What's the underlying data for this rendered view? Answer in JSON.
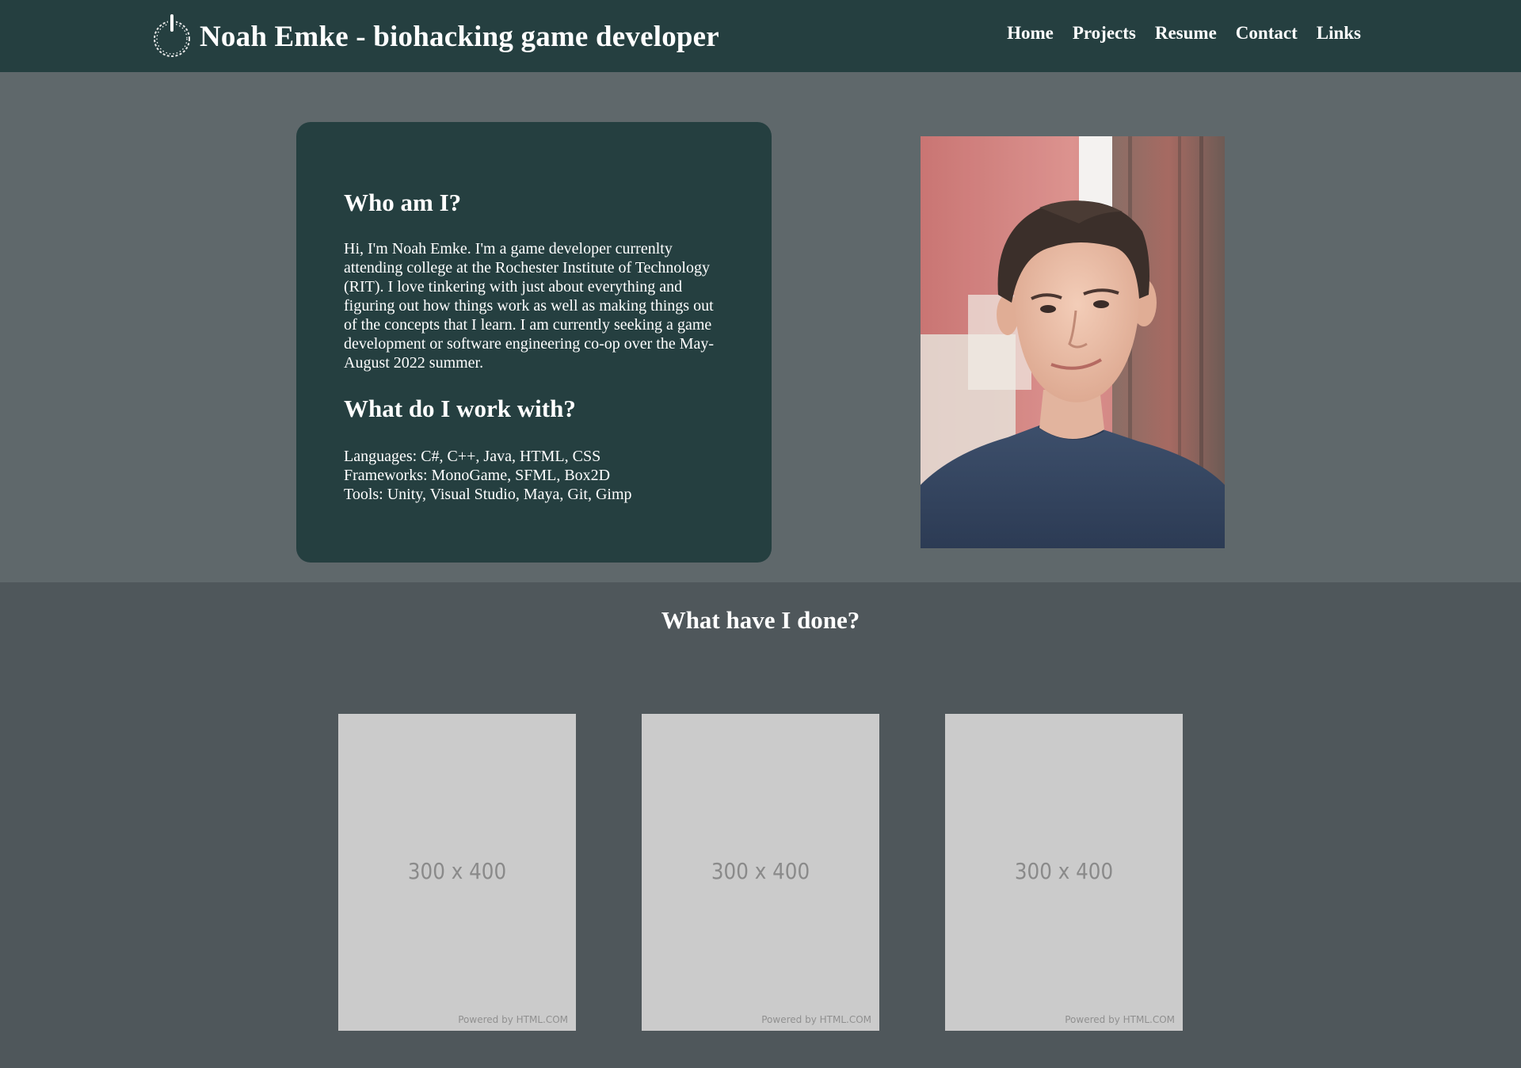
{
  "header": {
    "logo_icon": "power-icon",
    "title": "Noah Emke - biohacking game developer",
    "nav": [
      {
        "label": "Home"
      },
      {
        "label": "Projects"
      },
      {
        "label": "Resume"
      },
      {
        "label": "Contact"
      },
      {
        "label": "Links"
      }
    ]
  },
  "about": {
    "heading": "Who am I?",
    "bio": "Hi, I'm Noah Emke. I'm a game developer currenlty attending college at the Rochester Institute of Technology (RIT). I love tinkering with just about everything and figuring out how things work as well as making things out of the concepts that I learn. I am currently seeking a game development or software engineering co-op over the May-August 2022 summer.",
    "skills_heading": "What do I work with?",
    "languages": "Languages: C#, C++, Java, HTML, CSS",
    "frameworks": "Frameworks: MonoGame, SFML, Box2D",
    "tools": "Tools: Unity, Visual Studio, Maya, Git, Gimp"
  },
  "portrait": {
    "icon": "portrait-photo"
  },
  "projects": {
    "heading": "What have I done?",
    "items": [
      {
        "placeholder": "300 x 400",
        "credit": "Powered by HTML.COM"
      },
      {
        "placeholder": "300 x 400",
        "credit": "Powered by HTML.COM"
      },
      {
        "placeholder": "300 x 400",
        "credit": "Powered by HTML.COM"
      }
    ]
  },
  "colors": {
    "header_bg": "#253f40",
    "hero_bg": "#5f686b",
    "section_bg": "#4f575b",
    "card_bg": "#253f40",
    "placeholder_bg": "#cbcbcb"
  }
}
